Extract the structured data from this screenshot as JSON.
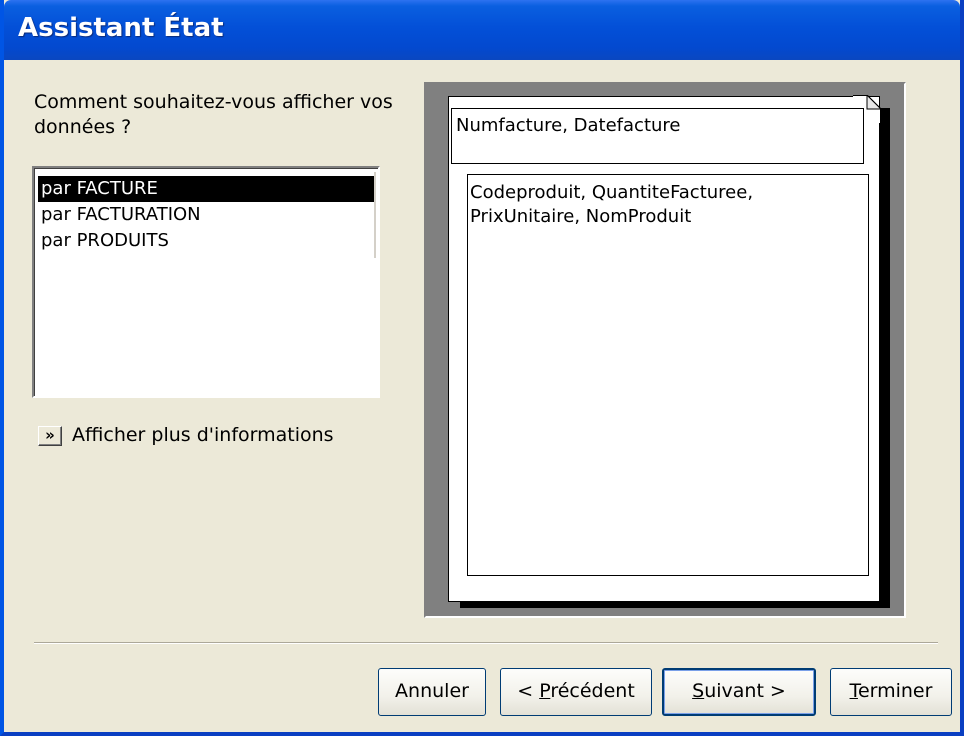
{
  "window": {
    "title": "Assistant État"
  },
  "wizard": {
    "prompt": "Comment souhaitez-vous afficher vos données ?",
    "list": {
      "items": [
        {
          "label": "par FACTURE",
          "selected": true
        },
        {
          "label": "par FACTURATION",
          "selected": false
        },
        {
          "label": "par PRODUITS",
          "selected": false
        }
      ]
    },
    "more_info": {
      "icon": "double-chevron-right-icon",
      "icon_glyph": "»",
      "label": "Afficher plus d'informations"
    },
    "preview": {
      "header_fields": "Numfacture, Datefacture",
      "detail_fields": "Codeproduit, QuantiteFacturee, PrixUnitaire, NomProduit"
    }
  },
  "buttons": {
    "cancel": "Annuler",
    "previous": {
      "prefix": "< ",
      "mnemonic": "P",
      "rest": "récédent"
    },
    "next": {
      "mnemonic": "S",
      "rest": "uivant >"
    },
    "finish": {
      "mnemonic": "T",
      "rest": "erminer"
    },
    "default": "next"
  },
  "colors": {
    "titlebar": "#0350d8",
    "face": "#ece9d8",
    "selection": "#000000"
  }
}
